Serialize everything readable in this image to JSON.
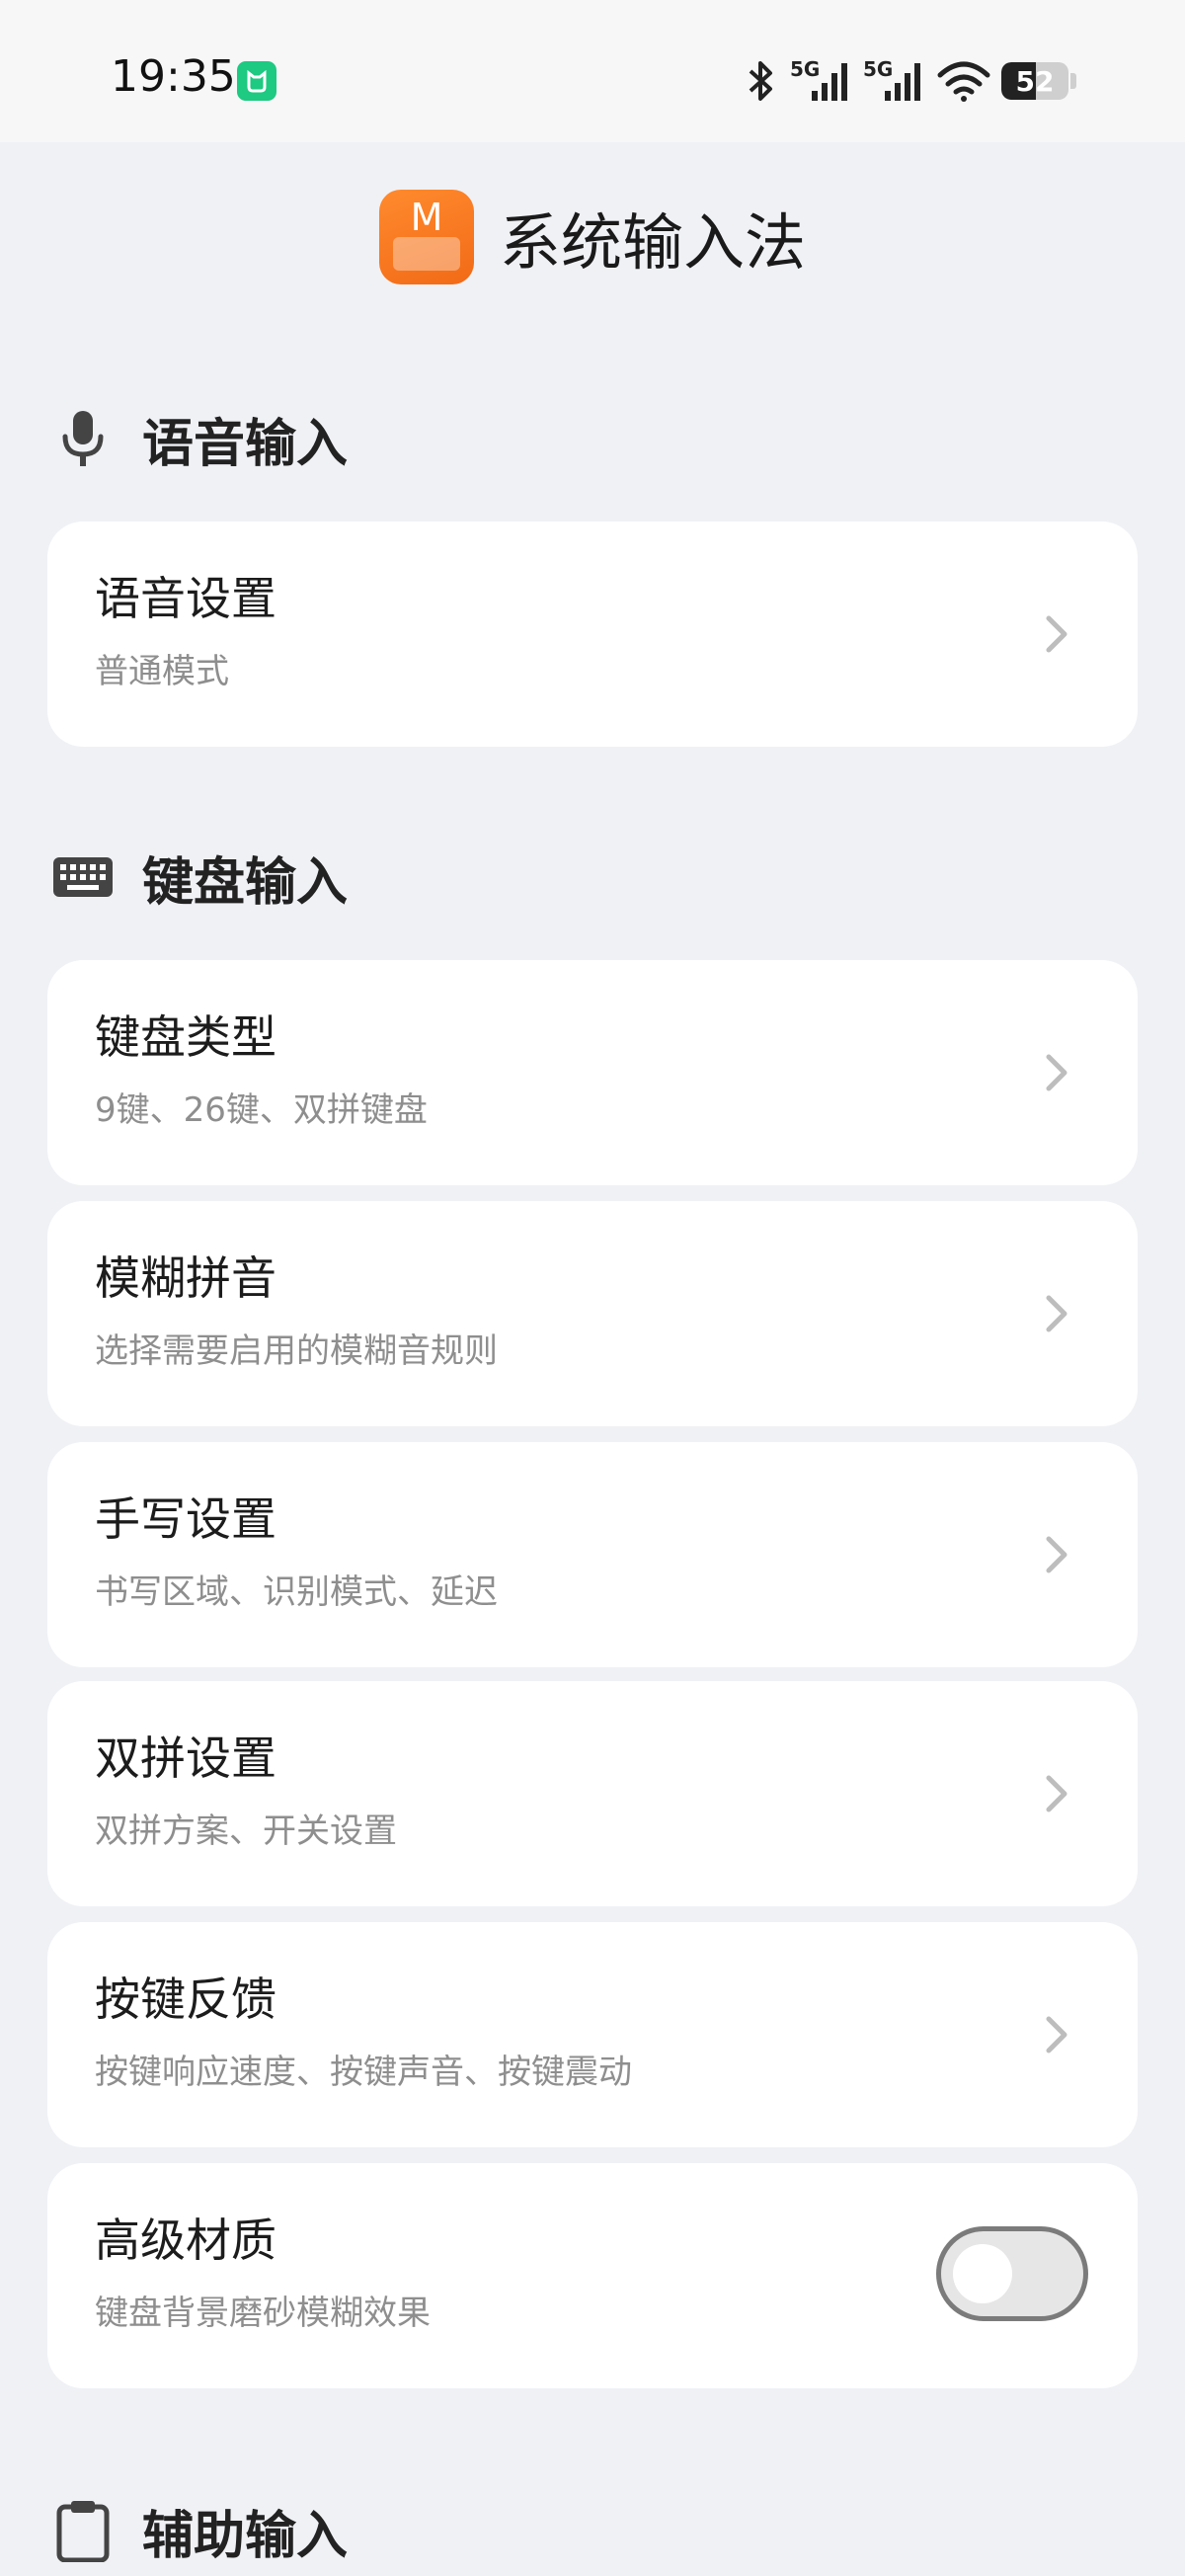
{
  "status_bar": {
    "time": "19:35",
    "battery": "52",
    "battery_level_percent": 52,
    "network_1": "5G",
    "network_2": "5G",
    "icons": [
      "app-notification-icon",
      "bluetooth-icon",
      "signal-icon",
      "signal-icon",
      "wifi-icon",
      "battery-icon"
    ]
  },
  "header": {
    "logo_letter": "M",
    "title": "系统输入法"
  },
  "sections": {
    "voice": {
      "title": "语音输入",
      "icon": "microphone-icon",
      "items": [
        {
          "title": "语音设置",
          "subtitle": "普通模式"
        }
      ]
    },
    "keyboard": {
      "title": "键盘输入",
      "icon": "keyboard-icon",
      "items": [
        {
          "title": "键盘类型",
          "subtitle": "9键、26键、双拼键盘"
        },
        {
          "title": "模糊拼音",
          "subtitle": "选择需要启用的模糊音规则"
        },
        {
          "title": "手写设置",
          "subtitle": "书写区域、识别模式、延迟"
        },
        {
          "title": "双拼设置",
          "subtitle": "双拼方案、开关设置"
        },
        {
          "title": "按键反馈",
          "subtitle": "按键响应速度、按键声音、按键震动"
        },
        {
          "title": "高级材质",
          "subtitle": "键盘背景磨砂模糊效果",
          "toggle": false
        }
      ]
    },
    "assist": {
      "title": "辅助输入",
      "icon": "clipboard-icon"
    }
  },
  "colors": {
    "background": "#f0f1f5",
    "card": "#ffffff",
    "accent_orange": "#f26a16",
    "subtitle_gray": "#8e8e8e"
  }
}
